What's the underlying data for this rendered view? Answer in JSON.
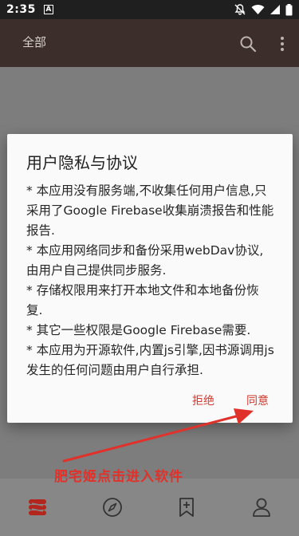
{
  "status_bar": {
    "time": "2:35",
    "notification_letter": "A",
    "icons": [
      "mute-icon",
      "wifi-icon",
      "signal-icon",
      "battery-icon"
    ]
  },
  "appbar": {
    "tab_label": "全部",
    "icons": [
      "search-icon",
      "more-vert-icon"
    ]
  },
  "dialog": {
    "title": "用户隐私与协议",
    "lines": [
      "* 本应用没有服务端,不收集任何用户信息,只采用了Google Firebase收集崩溃报告和性能报告.",
      "* 本应用网络同步和备份采用webDav协议,由用户自己提供同步服务.",
      "* 存储权限用来打开本地文件和本地备份恢复.",
      "* 其它一些权限是Google Firebase需要.",
      "* 本应用为开源软件,内置js引擎,因书源调用js发生的任何问题由用户自行承担."
    ],
    "reject_label": "拒绝",
    "accept_label": "同意"
  },
  "annotation": {
    "text": "肥宅姬点击进入软件",
    "color": "#e0312b"
  },
  "bottom_nav": {
    "items": [
      "bookshelf-icon",
      "compass-icon",
      "bookmark-add-icon",
      "person-icon"
    ]
  },
  "colors": {
    "appbar": "#3c2e2a",
    "accent": "#d33a2f"
  }
}
